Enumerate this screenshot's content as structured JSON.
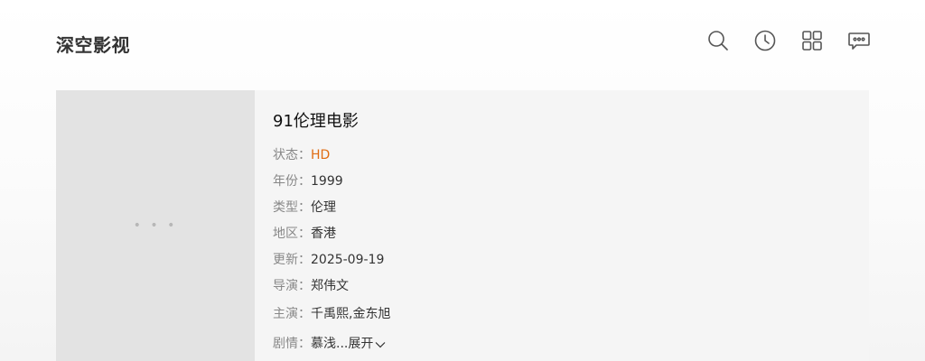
{
  "header": {
    "logo": "深空影视",
    "icons": [
      "search-icon",
      "history-icon",
      "grid-icon",
      "message-icon"
    ]
  },
  "movie": {
    "title": "91伦理电影",
    "status_label": "状态：",
    "status": "HD",
    "year_label": "年份：",
    "year": "1999",
    "genre_label": "类型：",
    "genre": "伦理",
    "region_label": "地区：",
    "region": "香港",
    "updated_label": "更新：",
    "updated": "2025-09-19",
    "director_label": "导演：",
    "director": "郑伟文",
    "cast_label": "主演：",
    "cast": "千禹熙,金东旭",
    "plot_label": "剧情：",
    "plot": "慕浅...",
    "expand_label": "展开"
  },
  "poster": {
    "placeholder": "• • •"
  },
  "colors": {
    "accent": "#e06c12",
    "card_bg": "#f5f5f5",
    "poster_bg": "#e3e3e3"
  }
}
